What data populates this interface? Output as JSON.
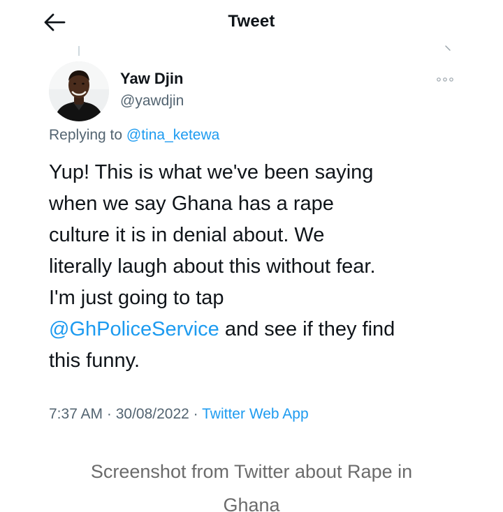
{
  "header": {
    "title": "Tweet",
    "back_icon": "arrow-left-icon"
  },
  "author": {
    "name": "Yaw Djin",
    "handle": "@yawdjin"
  },
  "reply": {
    "prefix": "Replying to",
    "to_handle": "@tina_ketewa"
  },
  "tweet": {
    "text_line_1": "Yup! This is what we've been saying",
    "text_line_2": "when we say Ghana has a rape",
    "text_line_3": "culture it is in denial about. We",
    "text_line_4": "literally laugh about this without fear.",
    "text_line_5": "I'm just going to tap",
    "mention": "@GhPoliceService",
    "text_after_mention": " and see if they find",
    "text_line_7": "this funny."
  },
  "meta": {
    "time": "7:37 AM",
    "separator": " · ",
    "date": "30/08/2022",
    "source": "Twitter Web App"
  },
  "caption": {
    "line_1": "Screenshot from Twitter about Rape in",
    "line_2": "Ghana"
  },
  "colors": {
    "link": "#1d9bf0",
    "secondary_text": "#536471",
    "primary_text": "#0f1419"
  }
}
